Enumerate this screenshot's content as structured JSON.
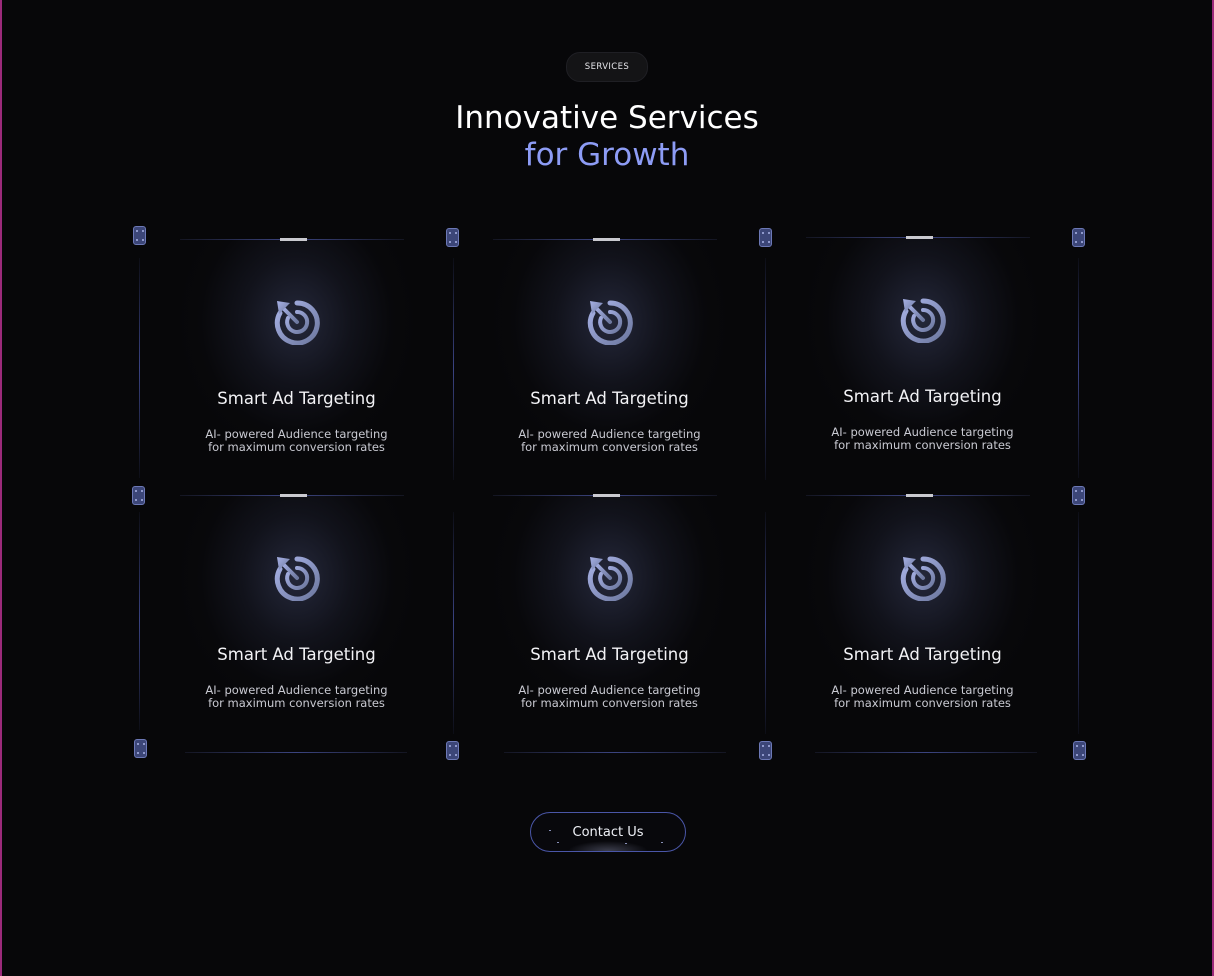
{
  "section_badge": "SERVICES",
  "heading": {
    "line1": "Innovative Services",
    "line2": "for Growth"
  },
  "colors": {
    "background": "#070709",
    "accent": "#8d9cf5",
    "line": "#3b4480",
    "node": "#3c4678"
  },
  "cards": [
    {
      "icon": "target-arrow-icon",
      "title": "Smart Ad Targeting",
      "desc_line1": "AI- powered Audience targeting",
      "desc_line2": "for maximum conversion rates"
    },
    {
      "icon": "target-arrow-icon",
      "title": "Smart Ad Targeting",
      "desc_line1": "AI- powered Audience targeting",
      "desc_line2": "for maximum conversion rates"
    },
    {
      "icon": "target-arrow-icon",
      "title": "Smart Ad Targeting",
      "desc_line1": "AI- powered Audience targeting",
      "desc_line2": "for maximum conversion rates"
    },
    {
      "icon": "target-arrow-icon",
      "title": "Smart Ad Targeting",
      "desc_line1": "AI- powered Audience targeting",
      "desc_line2": "for maximum conversion rates"
    },
    {
      "icon": "target-arrow-icon",
      "title": "Smart Ad Targeting",
      "desc_line1": "AI- powered Audience targeting",
      "desc_line2": "for maximum conversion rates"
    },
    {
      "icon": "target-arrow-icon",
      "title": "Smart Ad Targeting",
      "desc_line1": "AI- powered Audience targeting",
      "desc_line2": "for maximum conversion rates"
    }
  ],
  "cta": {
    "label": "Contact Us"
  }
}
